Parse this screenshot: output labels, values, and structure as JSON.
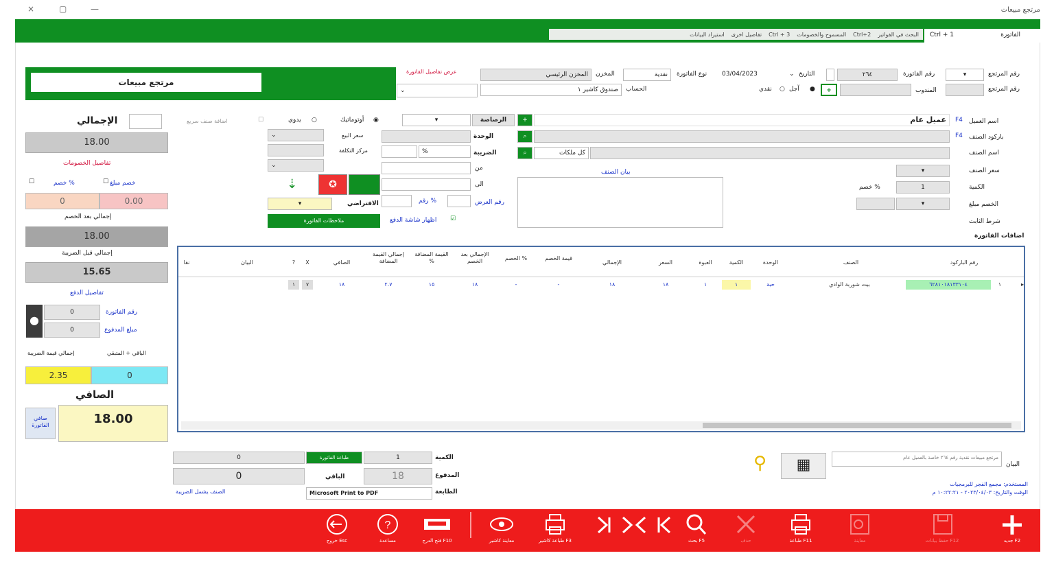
{
  "window": {
    "title": "مرتجع مبيعات",
    "controls": [
      "×",
      "▢",
      "—"
    ]
  },
  "ribbon": {
    "tab_active": "الفاتورة",
    "shortcut": "Ctrl + 1",
    "menu_items": [
      "البحث في الفواتير",
      "Ctrl+2",
      "المسموح والخصومات",
      "Ctrl + 3",
      "تفاصيل اخرى",
      "استيراد البيانات"
    ]
  },
  "banner": {
    "title": "مرتجع مبيعات",
    "warning_link": "عرض تفاصيل الفاتورة"
  },
  "header": {
    "return_no_label": "رقم المرتجع",
    "invoice_no_label": "رقم الفاتورة",
    "invoice_no_value": "٢٦٤",
    "date_label": "التاريخ",
    "date_value": "03/04/2023",
    "invoice_type_label": "نوع الفاتورة",
    "invoice_type_value": "نقدية",
    "store_label": "المخزن",
    "store_value": "المخزن الرئيسي",
    "delegate_label": "المندوب",
    "return_no2_label": "رقم المرتجع",
    "payment_cash": "نقدي",
    "payment_credit": "آجل",
    "account_label": "الحساب",
    "account_value": "صندوق كاشير ١"
  },
  "client": {
    "client_name_label": "اسم العميل",
    "client_name_value": "عميل عام",
    "barcode_label": "باركود الصنف",
    "item_name_label": "اسم الصنف",
    "item_price_label": "سعر الصنف",
    "qty_label": "الكمية",
    "qty_value": "1",
    "discount_pct_label": "خصم %",
    "discount_amount_label": "الخصم مبلغ",
    "item_cond_label": "شرط الثابت",
    "invoice_adds_label": "اضافات الفاتورة",
    "unit_label": "الوحدة",
    "tax_label": "الضريبة",
    "tax_combo": "كل ملكات",
    "item_desc_link": "بيان الصنف",
    "auto_label": "أوتوماتيك",
    "manual_label": "يدوي",
    "sale_price_label": "سعر البيع",
    "sale_center_label": "مركز التكلفة",
    "default_label": "الافتراضي",
    "percent_sign": "%",
    "serial_label": "رقم العرض",
    "tax_pct_label": "رقم %",
    "show_link": "اظهار شاشة الدفع",
    "notes_bar": "ملاحظات الفاتورة",
    "add_item_note": "اضافة صنف سريع"
  },
  "totals": {
    "total_label": "الإجمالي",
    "total_value": "18.00",
    "discount_details": "تفاصيل الخصومات",
    "discount_pct_label": "خصم %",
    "discount_amount_label": "خصم مبلغ",
    "discount_pct_value": "0",
    "discount_amount_value": "0.00",
    "after_discount_label": "إجمالي بعد الخصم",
    "after_discount_value": "18.00",
    "before_tax_label": "إجمالي قبل الضريبة",
    "before_tax_value": "15.65",
    "payment_details": "تفاصيل الدفع",
    "paid_no_label": "رقم الفاتورة",
    "paid_no_value": "0",
    "paid_amount_label": "مبلغ المدفوع",
    "paid_amount_value": "0",
    "tax_total_label": "إجمالي قيمة الضريبة",
    "remaining_label": "الباقي + المتبقي",
    "tax_total_value": "2.35",
    "remaining_value": "0",
    "net_label": "الصافي",
    "net_value": "18.00",
    "net_side": "صافي الفاتورة"
  },
  "grid": {
    "headers": [
      "رقم الباركود",
      "الصنف",
      "الوحدة",
      "الكمية",
      "العبوة",
      "السعر",
      "الإجمالي",
      "قيمة الخصم",
      "الخصم %",
      "الإجمالي بعد الخصم",
      "القيمة المضافة %",
      "إجمالي القيمة المضافة",
      "الصافي",
      "X",
      "?",
      "البيان",
      "نقا"
    ],
    "row": {
      "barcode": "٦٢٨١٠١٨١٣٣١٠٤",
      "item": "بيت شوربة الوادي",
      "unit": "حبة",
      "qty": "١",
      "pack": "١",
      "price": "١٨",
      "total": "١٨",
      "disc_value": "-",
      "disc_pct": "-",
      "after_disc": "١٨",
      "vat_pct": "١٥",
      "vat_total": "٢.٧",
      "net": "١٨",
      "x": "٧",
      "q": "١"
    }
  },
  "bottom": {
    "qty_label": "الكمية",
    "qty_value": "1",
    "qty_left_value": "0",
    "green_btn": "طباعة الفاتورة",
    "paid_label": "المدفوع",
    "paid_value": "18",
    "remain_label": "الباقي",
    "remain_value": "0",
    "printer_label": "الطابعة",
    "printer_value": "Microsoft Print to PDF",
    "tax_details_link": "الصنف يشمل الضريبة",
    "notes_label": "البيان",
    "notes_value": "مرتجع مبيعات نقدية رقم ٢٦٤ خاصة بالعميل عام",
    "user_line": "المستخدم: مجمع الفجر للبرمجيات",
    "datetime_line": "الوقت والتاريخ: ٢٠٢٣/٠٤/٠٣ - ١٠:٢٢:٢١ م"
  },
  "toolbar": {
    "new": "جديد F2",
    "save": "حفظ بيانات F12",
    "preview": "معاينة",
    "print": "طباعة F11",
    "delete": "حذف",
    "search": "بحث F5",
    "first": "الأول",
    "next": "التالي",
    "prev": "السابق",
    "last": "الأخير",
    "print_cashier": "طباعة كاشير F3",
    "cashier_preview": "معاينة كاشير",
    "open_drawer": "فتح الدرج F10",
    "help": "مساعدة",
    "exit": "خروج Esc"
  }
}
